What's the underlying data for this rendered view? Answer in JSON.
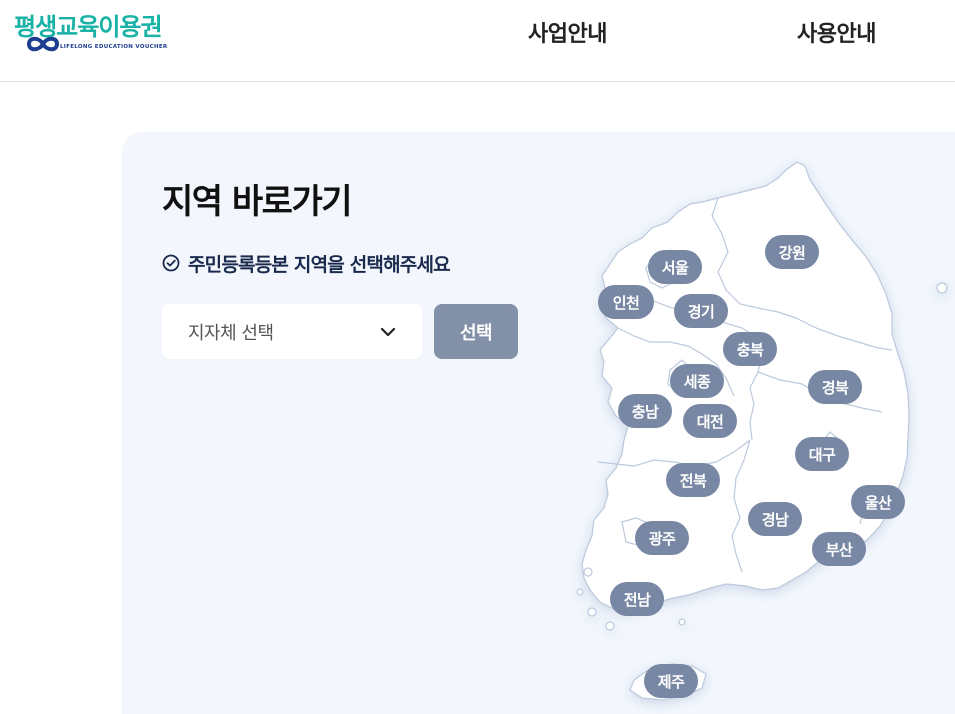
{
  "header": {
    "logo_text_part1": "평생교",
    "logo_text_part2": "육이용권",
    "logo_subtitle": "LIFELONG EDUCATION VOUCHER",
    "nav": [
      {
        "label": "사업안내"
      },
      {
        "label": "사용안내"
      }
    ]
  },
  "panel": {
    "title": "지역 바로가기",
    "guide": "주민등록등본 지역을 선택해주세요",
    "select_placeholder": "지자체 선택",
    "select_button": "선택"
  },
  "regions": [
    {
      "id": "seoul",
      "label": "서울"
    },
    {
      "id": "incheon",
      "label": "인천"
    },
    {
      "id": "gyeonggi",
      "label": "경기"
    },
    {
      "id": "gangwon",
      "label": "강원"
    },
    {
      "id": "chungbuk",
      "label": "충북"
    },
    {
      "id": "sejong",
      "label": "세종"
    },
    {
      "id": "chungnam",
      "label": "충남"
    },
    {
      "id": "daejeon",
      "label": "대전"
    },
    {
      "id": "gyeongbuk",
      "label": "경북"
    },
    {
      "id": "daegu",
      "label": "대구"
    },
    {
      "id": "jeonbuk",
      "label": "전북"
    },
    {
      "id": "ulsan",
      "label": "울산"
    },
    {
      "id": "gyeongnam",
      "label": "경남"
    },
    {
      "id": "gwangju",
      "label": "광주"
    },
    {
      "id": "busan",
      "label": "부산"
    },
    {
      "id": "jeonnam",
      "label": "전남"
    },
    {
      "id": "jeju",
      "label": "제주"
    }
  ],
  "colors": {
    "brand_teal": "#18b2a6",
    "brand_navy": "#1d3e8f",
    "panel_bg": "#f3f7fd",
    "button_bg": "#8290a8",
    "region_pill": "#7887a3",
    "map_land": "#ffffff",
    "map_border": "#bcc9dc"
  },
  "icons": {
    "guide": "check-circle-icon",
    "select": "chevron-down-icon"
  }
}
